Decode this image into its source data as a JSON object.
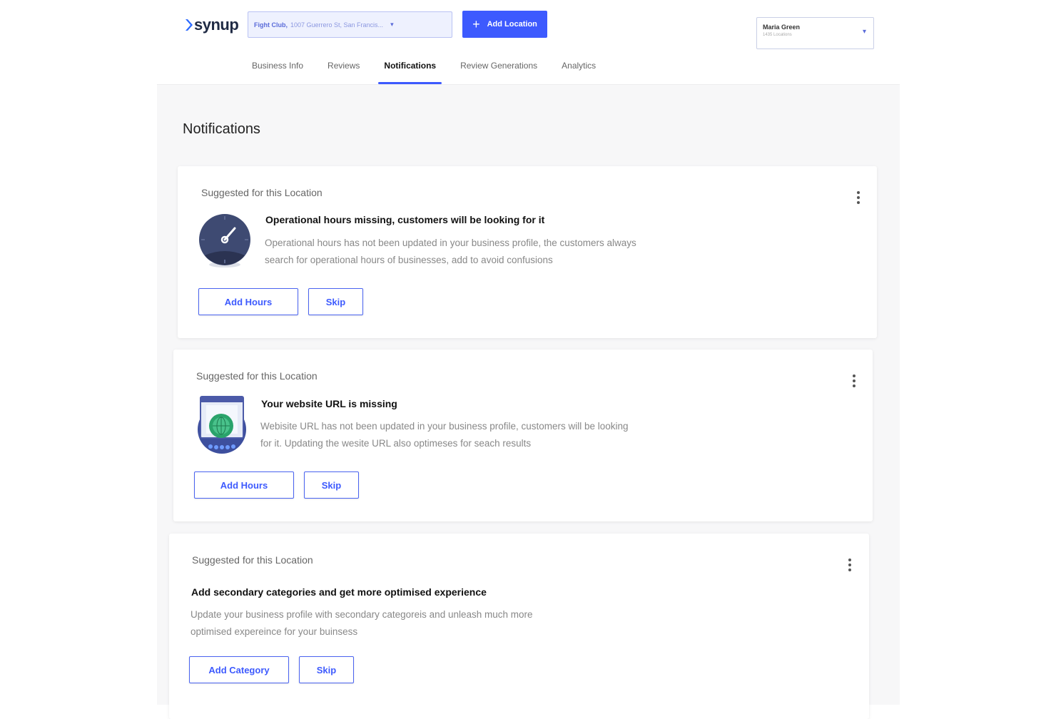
{
  "brand": {
    "logo_text": "synup"
  },
  "location_selector": {
    "name": "Fight Club,",
    "address": "1007 Guerrero St, San Francis..."
  },
  "add_location_button": {
    "label": "Add Location"
  },
  "user_menu": {
    "name": "Maria Green",
    "subtitle": "1435 Locations"
  },
  "tabs": [
    {
      "label": "Business Info",
      "active": false
    },
    {
      "label": "Reviews",
      "active": false
    },
    {
      "label": "Notifications",
      "active": true
    },
    {
      "label": "Review Generations",
      "active": false
    },
    {
      "label": "Analytics",
      "active": false
    }
  ],
  "page_title": "Notifications",
  "cards": [
    {
      "label": "Suggested for this Location",
      "icon": "clock-icon",
      "title": "Operational hours missing, customers will be looking for it",
      "desc_line1": "Operational hours has not been updated in your business profile, the customers always",
      "desc_line2": "search for operational hours of businesses, add to avoid confusions",
      "primary_label": "Add Hours",
      "skip_label": "Skip"
    },
    {
      "label": "Suggested for this Location",
      "icon": "website-globe-icon",
      "title": "Your website URL is missing",
      "desc_line1": "Webisite URL has not been updated in your business profile, customers will be looking",
      "desc_line2": "for it. Updating the wesite URL also optimeses for seach results",
      "primary_label": "Add Hours",
      "skip_label": "Skip"
    },
    {
      "label": "Suggested for this Location",
      "title": "Add secondary categories and get more optimised experience",
      "desc_line1": "Update your business profile with secondary categoreis and unleash much more",
      "desc_line2": "optimised expereince for your buinsess",
      "primary_label": "Add Category",
      "skip_label": "Skip"
    }
  ],
  "colors": {
    "accent": "#3d5afe",
    "clock_face": "#3e4a72"
  }
}
